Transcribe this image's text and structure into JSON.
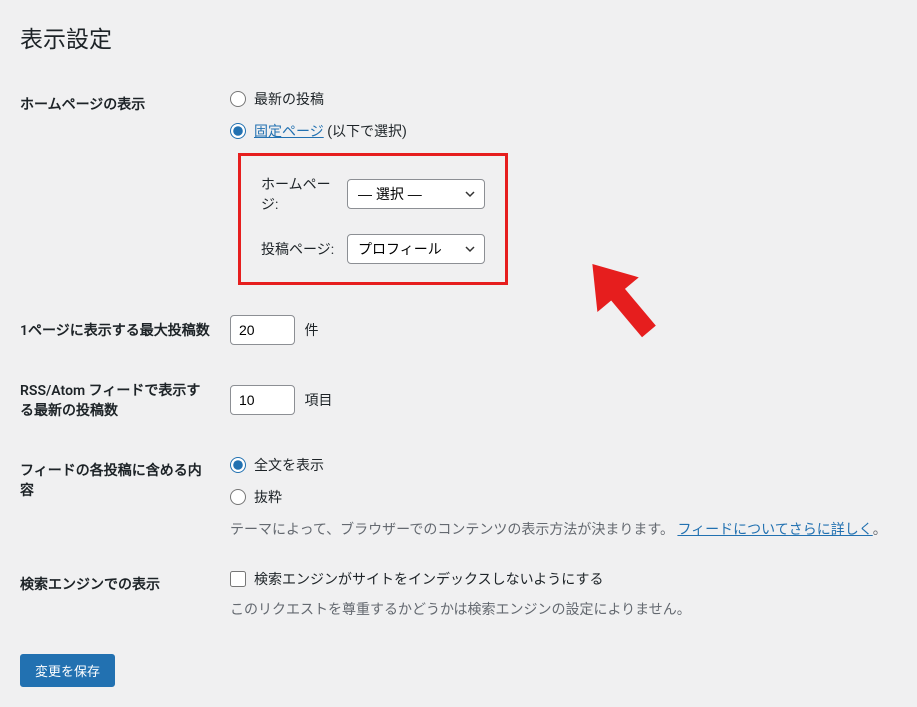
{
  "page": {
    "title": "表示設定"
  },
  "homepage": {
    "label": "ホームページの表示",
    "option_latest": "最新の投稿",
    "option_static_link": "固定ページ",
    "option_static_suffix": " (以下で選択)",
    "homepage_label": "ホームページ:",
    "homepage_selected": "— 選択 —",
    "posts_page_label": "投稿ページ:",
    "posts_page_selected": "プロフィール"
  },
  "posts_per_page": {
    "label": "1ページに表示する最大投稿数",
    "value": "20",
    "unit": "件"
  },
  "rss": {
    "label": "RSS/Atom フィードで表示する最新の投稿数",
    "value": "10",
    "unit": "項目"
  },
  "feed_content": {
    "label": "フィードの各投稿に含める内容",
    "option_full": "全文を表示",
    "option_excerpt": "抜粋",
    "description_prefix": "テーマによって、ブラウザーでのコンテンツの表示方法が決まります。",
    "description_link": "フィードについてさらに詳しく",
    "description_suffix": "。"
  },
  "search_engine": {
    "label": "検索エンジンでの表示",
    "checkbox_label": "検索エンジンがサイトをインデックスしないようにする",
    "description": "このリクエストを尊重するかどうかは検索エンジンの設定によりません。"
  },
  "submit": {
    "label": "変更を保存"
  }
}
